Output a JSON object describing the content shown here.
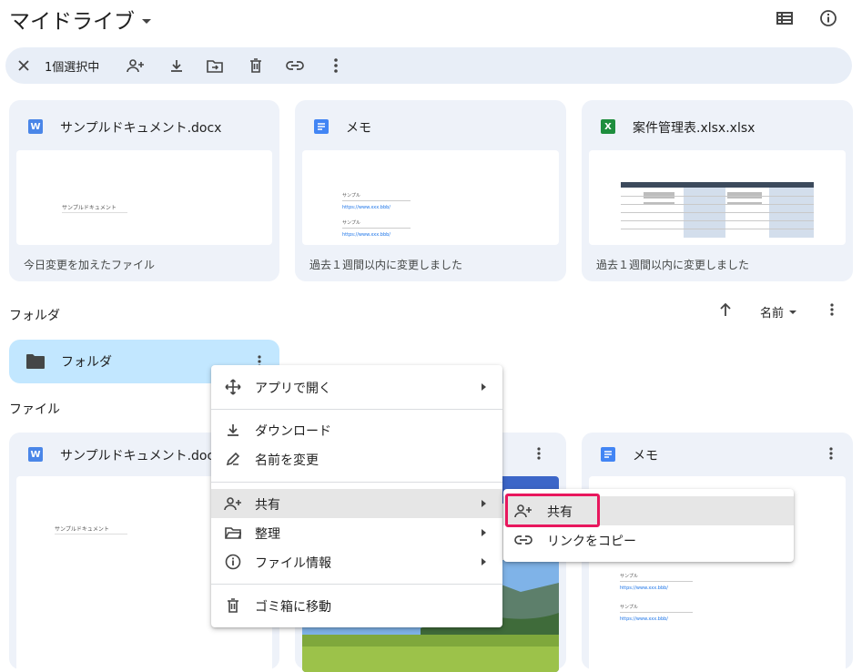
{
  "header": {
    "title": "マイドライブ",
    "list_view_icon": "list-view-icon",
    "info_icon": "info-icon"
  },
  "selection_bar": {
    "count_label": "1個選択中",
    "actions": [
      "close-icon",
      "share-icon",
      "download-icon",
      "move-icon",
      "trash-icon",
      "link-icon",
      "more-vert-icon"
    ]
  },
  "suggested": [
    {
      "name": "サンプルドキュメント.docx",
      "type": "word",
      "icon_letter": "W",
      "subtitle": "今日変更を加えたファイル",
      "preview_text": "サンプルドキュメント"
    },
    {
      "name": "メモ",
      "type": "docs",
      "icon_letter": "",
      "subtitle": "過去１週間以内に変更しました",
      "preview_lines": [
        "サンプル",
        "https://www.xxx.bbb/",
        "サンプル",
        "https://www.xxx.bbb/"
      ]
    },
    {
      "name": "案件管理表.xlsx.xlsx",
      "type": "excel",
      "icon_letter": "X",
      "subtitle": "過去１週間以内に変更しました"
    }
  ],
  "folders_section": {
    "label": "フォルダ",
    "sort_label": "名前",
    "folder_name": "フォルダ"
  },
  "files_section": {
    "label": "ファイル",
    "files": [
      {
        "name": "サンプルドキュメント.docx",
        "icon_letter": "W",
        "preview_text": "サンプルドキュメント"
      },
      {
        "name": "",
        "type": "image"
      },
      {
        "name": "メモ",
        "preview_lines": [
          "サンプル",
          "https://www.xxx.bbb/",
          "サンプル",
          "https://www.xxx.bbb/"
        ]
      }
    ]
  },
  "context_menu": {
    "open_with": "アプリで開く",
    "download": "ダウンロード",
    "rename": "名前を変更",
    "share": "共有",
    "organize": "整理",
    "file_info": "ファイル情報",
    "trash": "ゴミ箱に移動"
  },
  "share_submenu": {
    "share": "共有",
    "copy_link": "リンクをコピー"
  },
  "colors": {
    "accent_blue": "#0b57d0",
    "selection_bar": "#e8eef7",
    "card_bg": "#eef2f9",
    "folder_selected": "#c2e7ff",
    "highlight_border": "#e8175d",
    "word_blue": "#4a86e8",
    "excel_green": "#1e8e3e",
    "docs_blue": "#4285f4"
  }
}
